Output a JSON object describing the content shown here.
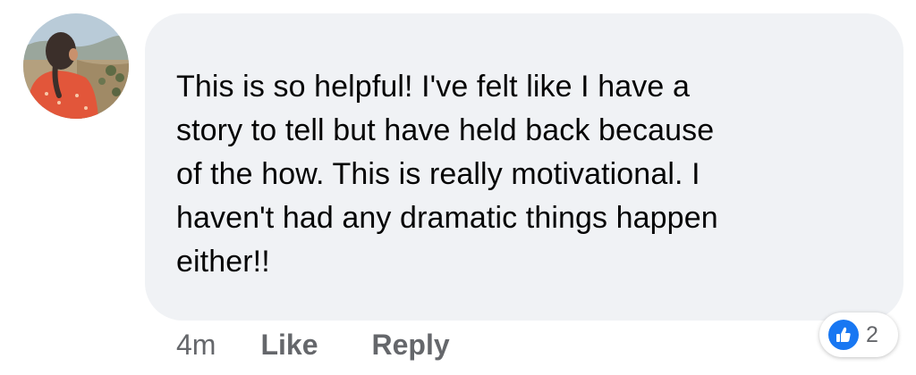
{
  "comment": {
    "text": "This is so helpful! I've felt like I have a\nstory to tell but have held back because\nof the how. This is really motivational. I\nhaven't had any dramatic things happen\neither!!",
    "timestamp": "4m",
    "like_label": "Like",
    "reply_label": "Reply",
    "reactions": {
      "icon": "thumbs-up-icon",
      "count": "2",
      "color": "#1877f2"
    }
  },
  "colors": {
    "bubble": "#f0f2f5",
    "text": "#050505",
    "secondary_text": "#65676b",
    "like_blue": "#1877f2"
  }
}
